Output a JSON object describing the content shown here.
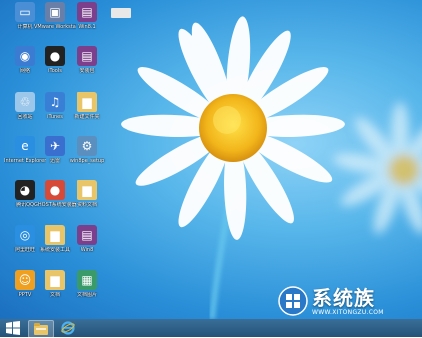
{
  "desktop": {
    "icons": [
      {
        "label": "计算机",
        "icon": "computer-icon",
        "color": "#4a8fd6",
        "glyph": "▭"
      },
      {
        "label": "VMware Workstation",
        "icon": "vmware-icon",
        "color": "#6a7fa8",
        "glyph": "▣"
      },
      {
        "label": "Win8.1",
        "icon": "archive-icon",
        "color": "#7b3f8c",
        "glyph": "▤"
      },
      {
        "label": "",
        "icon": "blank-file-icon",
        "color": "#e8e8e8",
        "glyph": ""
      },
      {
        "label": "网络",
        "icon": "network-icon",
        "color": "#3b7bd1",
        "glyph": "◉"
      },
      {
        "label": "iTools",
        "icon": "itools-icon",
        "color": "#222222",
        "glyph": "●"
      },
      {
        "label": "安装包",
        "icon": "archive-icon",
        "color": "#7b3f8c",
        "glyph": "▤"
      },
      {
        "label": "回收站",
        "icon": "recycle-bin-icon",
        "color": "#9cc7ea",
        "glyph": "♲"
      },
      {
        "label": "iTunes",
        "icon": "itunes-icon",
        "color": "#3a7fd6",
        "glyph": "♫"
      },
      {
        "label": "新建文件夹",
        "icon": "folder-icon",
        "color": "#e9c56a",
        "glyph": "▆"
      },
      {
        "label": "Internet Explorer",
        "icon": "ie-icon",
        "color": "#2a8fe0",
        "glyph": "e"
      },
      {
        "label": "迅雷",
        "icon": "xunlei-icon",
        "color": "#3a6fd0",
        "glyph": "✈"
      },
      {
        "label": "win8pe_setup",
        "icon": "setup-icon",
        "color": "#5a8fc0",
        "glyph": "⚙"
      },
      {
        "label": "腾讯QQ",
        "icon": "qq-icon",
        "color": "#222222",
        "glyph": "◕"
      },
      {
        "label": "GHOST系统安装器",
        "icon": "ghost-icon",
        "color": "#d64a3a",
        "glyph": "●"
      },
      {
        "label": "资料文档",
        "icon": "folder-icon",
        "color": "#e9c56a",
        "glyph": "▆"
      },
      {
        "label": "阿里旺旺",
        "icon": "aliwangwang-icon",
        "color": "#2a8fe0",
        "glyph": "◎"
      },
      {
        "label": "系统安装工具",
        "icon": "folder-icon",
        "color": "#e9c56a",
        "glyph": "▆"
      },
      {
        "label": "Win8",
        "icon": "archive-icon",
        "color": "#7b3f8c",
        "glyph": "▤"
      },
      {
        "label": "PPTV",
        "icon": "pptv-icon",
        "color": "#f0a020",
        "glyph": "☺"
      },
      {
        "label": "文档",
        "icon": "folder-icon",
        "color": "#e9c56a",
        "glyph": "▆"
      },
      {
        "label": "文档图片",
        "icon": "image-icon",
        "color": "#3a9a6a",
        "glyph": "▦"
      }
    ]
  },
  "taskbar": {
    "start_icon": "windows-start-icon",
    "items": [
      {
        "name": "file-explorer-icon",
        "active": true
      },
      {
        "name": "internet-explorer-icon",
        "active": false
      }
    ]
  },
  "watermark": {
    "title": "系统族",
    "url": "WWW.XITONGZU.COM"
  },
  "colors": {
    "sky_light": "#8fd3f7",
    "sky_dark": "#1b6fbf",
    "taskbar": "#2f6089",
    "petal": "#ffffff",
    "flower_center": "#f2c41a"
  }
}
